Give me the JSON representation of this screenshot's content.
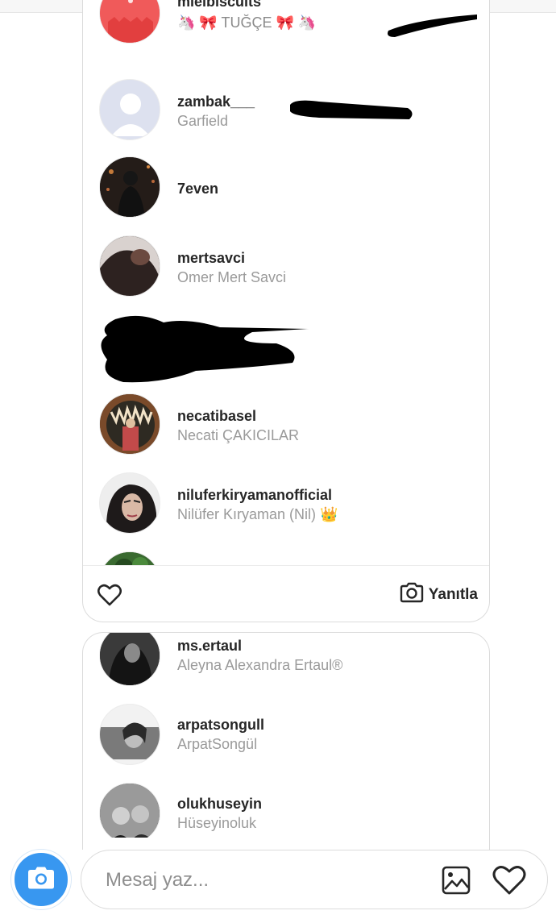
{
  "card1": {
    "rows": [
      {
        "username": "mielbiscuits",
        "fullname": "🦄 🎀 TUĞÇE 🎀 🦄"
      },
      {
        "username": "zambak___",
        "fullname": "Garfield"
      },
      {
        "username": "7even",
        "fullname": ""
      },
      {
        "username": "mertsavci",
        "fullname": "Omer Mert Savci"
      },
      {
        "username": "",
        "fullname": ""
      },
      {
        "username": "necatibasel",
        "fullname": "Necati ÇAKICILAR"
      },
      {
        "username": "niluferkiryamanofficial",
        "fullname": "Nilüfer Kıryaman (Nil) 👑"
      }
    ],
    "footer": {
      "reply_label": "Yanıtla"
    }
  },
  "card2": {
    "rows": [
      {
        "username": "ms.ertaul",
        "fullname": "Aleyna Alexandra Ertaul®"
      },
      {
        "username": "arpatsongull",
        "fullname": "ArpatSongül"
      },
      {
        "username": "olukhuseyin",
        "fullname": "Hüseyinoluk"
      }
    ]
  },
  "composer": {
    "placeholder": "Mesaj yaz..."
  },
  "icons": {
    "heart": "heart-icon",
    "camera": "camera-icon",
    "gallery": "image-gallery-icon",
    "default_avatar": "default-user-avatar-icon"
  },
  "colors": {
    "accent": "#3897f0",
    "text": "#262626",
    "muted": "#9a9a9a",
    "border": "#dbdbdb"
  }
}
